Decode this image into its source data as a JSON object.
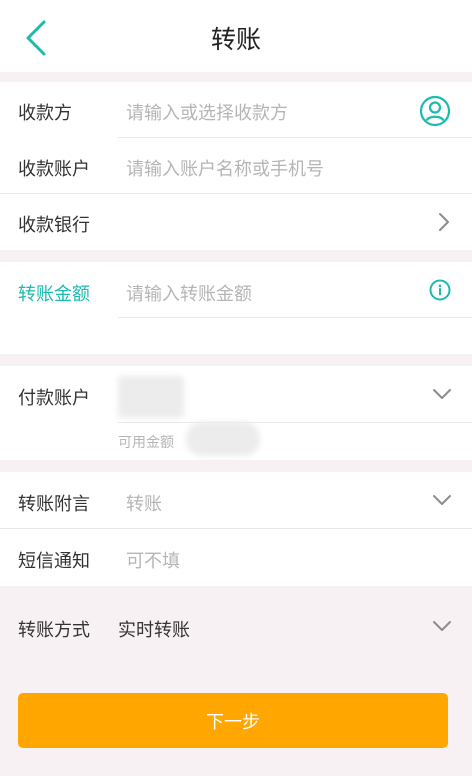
{
  "header": {
    "title": "转账"
  },
  "payee": {
    "name_label": "收款方",
    "name_placeholder": "请输入或选择收款方",
    "account_label": "收款账户",
    "account_placeholder": "请输入账户名称或手机号",
    "bank_label": "收款银行"
  },
  "amount": {
    "label": "转账金额",
    "placeholder": "请输入转账金额"
  },
  "payer": {
    "account_label": "付款账户",
    "available_label": "可用金额"
  },
  "extra": {
    "memo_label": "转账附言",
    "memo_value": "转账",
    "sms_label": "短信通知",
    "sms_placeholder": "可不填"
  },
  "method": {
    "label": "转账方式",
    "value": "实时转账"
  },
  "actions": {
    "next_label": "下一步"
  },
  "colors": {
    "accent": "#1dbab0",
    "button": "#ffa600",
    "background": "#f7f1f4"
  }
}
